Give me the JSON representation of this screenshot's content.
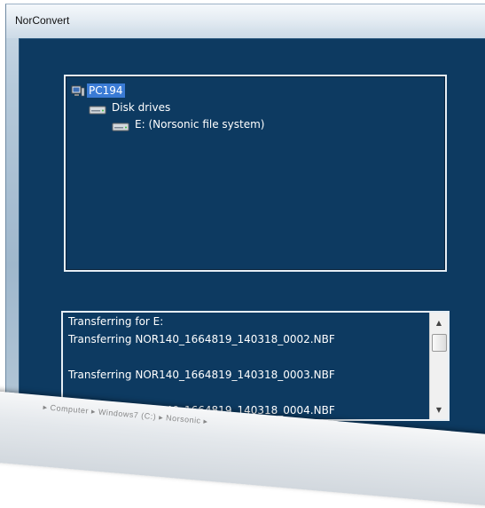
{
  "window": {
    "title": "NorConvert"
  },
  "tree": {
    "root": {
      "label": "PC194",
      "icon": "computer-icon"
    },
    "group": {
      "label": "Disk drives",
      "icon": "disk-drive-icon"
    },
    "drive": {
      "label": "E: (Norsonic file system)",
      "icon": "disk-drive-icon"
    }
  },
  "log": {
    "lines": [
      "Transferring for E:",
      "Transferring NOR140_1664819_140318_0002.NBF",
      "",
      "Transferring NOR140_1664819_140318_0003.NBF",
      "",
      "Transferring NOR140_1664819_140318_0004.NBF"
    ],
    "scroll_up_icon": "scroll-up-arrow",
    "scroll_down_icon": "scroll-down-arrow"
  },
  "taskbar": {
    "breadcrumb": "▸ Computer ▸ Windows7 (C:) ▸ Norsonic ▸"
  },
  "colors": {
    "client_background": "#0d3a61",
    "selection": "#3a7bd5",
    "text": "#ffffff"
  }
}
